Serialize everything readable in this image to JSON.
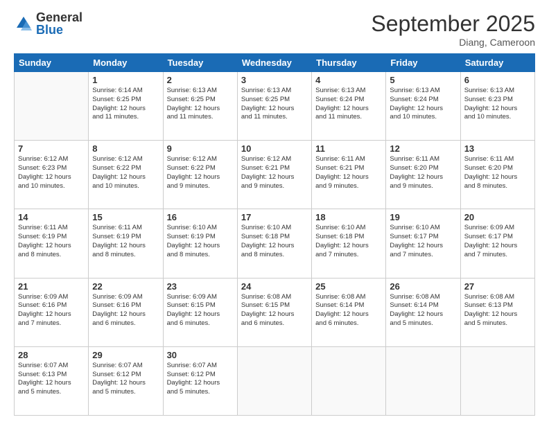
{
  "logo": {
    "general": "General",
    "blue": "Blue"
  },
  "title": "September 2025",
  "location": "Diang, Cameroon",
  "days_of_week": [
    "Sunday",
    "Monday",
    "Tuesday",
    "Wednesday",
    "Thursday",
    "Friday",
    "Saturday"
  ],
  "weeks": [
    [
      {
        "day": "",
        "info": ""
      },
      {
        "day": "1",
        "info": "Sunrise: 6:14 AM\nSunset: 6:25 PM\nDaylight: 12 hours\nand 11 minutes."
      },
      {
        "day": "2",
        "info": "Sunrise: 6:13 AM\nSunset: 6:25 PM\nDaylight: 12 hours\nand 11 minutes."
      },
      {
        "day": "3",
        "info": "Sunrise: 6:13 AM\nSunset: 6:25 PM\nDaylight: 12 hours\nand 11 minutes."
      },
      {
        "day": "4",
        "info": "Sunrise: 6:13 AM\nSunset: 6:24 PM\nDaylight: 12 hours\nand 11 minutes."
      },
      {
        "day": "5",
        "info": "Sunrise: 6:13 AM\nSunset: 6:24 PM\nDaylight: 12 hours\nand 10 minutes."
      },
      {
        "day": "6",
        "info": "Sunrise: 6:13 AM\nSunset: 6:23 PM\nDaylight: 12 hours\nand 10 minutes."
      }
    ],
    [
      {
        "day": "7",
        "info": "Sunrise: 6:12 AM\nSunset: 6:23 PM\nDaylight: 12 hours\nand 10 minutes."
      },
      {
        "day": "8",
        "info": "Sunrise: 6:12 AM\nSunset: 6:22 PM\nDaylight: 12 hours\nand 10 minutes."
      },
      {
        "day": "9",
        "info": "Sunrise: 6:12 AM\nSunset: 6:22 PM\nDaylight: 12 hours\nand 9 minutes."
      },
      {
        "day": "10",
        "info": "Sunrise: 6:12 AM\nSunset: 6:21 PM\nDaylight: 12 hours\nand 9 minutes."
      },
      {
        "day": "11",
        "info": "Sunrise: 6:11 AM\nSunset: 6:21 PM\nDaylight: 12 hours\nand 9 minutes."
      },
      {
        "day": "12",
        "info": "Sunrise: 6:11 AM\nSunset: 6:20 PM\nDaylight: 12 hours\nand 9 minutes."
      },
      {
        "day": "13",
        "info": "Sunrise: 6:11 AM\nSunset: 6:20 PM\nDaylight: 12 hours\nand 8 minutes."
      }
    ],
    [
      {
        "day": "14",
        "info": "Sunrise: 6:11 AM\nSunset: 6:19 PM\nDaylight: 12 hours\nand 8 minutes."
      },
      {
        "day": "15",
        "info": "Sunrise: 6:11 AM\nSunset: 6:19 PM\nDaylight: 12 hours\nand 8 minutes."
      },
      {
        "day": "16",
        "info": "Sunrise: 6:10 AM\nSunset: 6:19 PM\nDaylight: 12 hours\nand 8 minutes."
      },
      {
        "day": "17",
        "info": "Sunrise: 6:10 AM\nSunset: 6:18 PM\nDaylight: 12 hours\nand 8 minutes."
      },
      {
        "day": "18",
        "info": "Sunrise: 6:10 AM\nSunset: 6:18 PM\nDaylight: 12 hours\nand 7 minutes."
      },
      {
        "day": "19",
        "info": "Sunrise: 6:10 AM\nSunset: 6:17 PM\nDaylight: 12 hours\nand 7 minutes."
      },
      {
        "day": "20",
        "info": "Sunrise: 6:09 AM\nSunset: 6:17 PM\nDaylight: 12 hours\nand 7 minutes."
      }
    ],
    [
      {
        "day": "21",
        "info": "Sunrise: 6:09 AM\nSunset: 6:16 PM\nDaylight: 12 hours\nand 7 minutes."
      },
      {
        "day": "22",
        "info": "Sunrise: 6:09 AM\nSunset: 6:16 PM\nDaylight: 12 hours\nand 6 minutes."
      },
      {
        "day": "23",
        "info": "Sunrise: 6:09 AM\nSunset: 6:15 PM\nDaylight: 12 hours\nand 6 minutes."
      },
      {
        "day": "24",
        "info": "Sunrise: 6:08 AM\nSunset: 6:15 PM\nDaylight: 12 hours\nand 6 minutes."
      },
      {
        "day": "25",
        "info": "Sunrise: 6:08 AM\nSunset: 6:14 PM\nDaylight: 12 hours\nand 6 minutes."
      },
      {
        "day": "26",
        "info": "Sunrise: 6:08 AM\nSunset: 6:14 PM\nDaylight: 12 hours\nand 5 minutes."
      },
      {
        "day": "27",
        "info": "Sunrise: 6:08 AM\nSunset: 6:13 PM\nDaylight: 12 hours\nand 5 minutes."
      }
    ],
    [
      {
        "day": "28",
        "info": "Sunrise: 6:07 AM\nSunset: 6:13 PM\nDaylight: 12 hours\nand 5 minutes."
      },
      {
        "day": "29",
        "info": "Sunrise: 6:07 AM\nSunset: 6:12 PM\nDaylight: 12 hours\nand 5 minutes."
      },
      {
        "day": "30",
        "info": "Sunrise: 6:07 AM\nSunset: 6:12 PM\nDaylight: 12 hours\nand 5 minutes."
      },
      {
        "day": "",
        "info": ""
      },
      {
        "day": "",
        "info": ""
      },
      {
        "day": "",
        "info": ""
      },
      {
        "day": "",
        "info": ""
      }
    ]
  ]
}
